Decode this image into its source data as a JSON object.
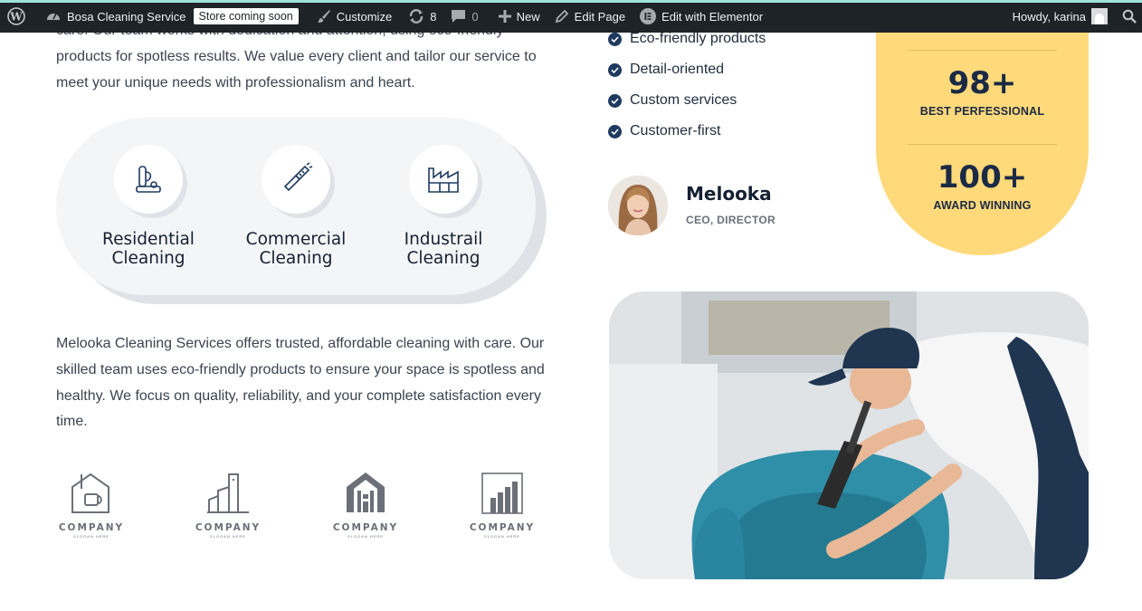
{
  "admin_bar": {
    "site_name": "Bosa Cleaning Service",
    "store_badge": "Store coming soon",
    "customize": "Customize",
    "updates_count": "8",
    "comments_count": "0",
    "new": "New",
    "edit_page": "Edit Page",
    "edit_elementor": "Edit with Elementor",
    "howdy": "Howdy, karina"
  },
  "intro": {
    "paragraph": "care. Our team works with dedication and attention, using eco-friendly products for spotless results. We value every client and tailor our service to meet your unique needs with professionalism and heart."
  },
  "services": [
    {
      "title_line1": "Residential",
      "title_line2": "Cleaning",
      "icon": "vacuum-icon"
    },
    {
      "title_line1": "Commercial",
      "title_line2": "Cleaning",
      "icon": "brush-icon"
    },
    {
      "title_line1": "Industrail",
      "title_line2": "Cleaning",
      "icon": "factory-icon"
    }
  ],
  "about": {
    "paragraph": "Melooka Cleaning Services offers trusted, affordable cleaning with care. Our skilled team uses eco-friendly products to ensure your space is spotless and healthy. We focus on quality, reliability, and your complete satisfaction every time."
  },
  "logos": [
    {
      "word": "COMPANY",
      "sub": "SLOGAN HERE",
      "icon": "house-logo-icon"
    },
    {
      "word": "COMPANY",
      "sub": "SLOGAN HERE",
      "icon": "buildings-logo-icon"
    },
    {
      "word": "COMPANY",
      "sub": "SLOGAN HERE",
      "icon": "home-logo-icon"
    },
    {
      "word": "COMPANY",
      "sub": "SLOGAN HERE",
      "icon": "city-logo-icon"
    }
  ],
  "features": [
    "Eco-friendly products",
    "Detail-oriented",
    "Custom services",
    "Customer-first"
  ],
  "person": {
    "name": "Melooka",
    "role": "CEO, DIRECTOR"
  },
  "stats": [
    {
      "number": "98+",
      "label": "BEST PERFESSIONAL"
    },
    {
      "number": "100+",
      "label": "AWARD WINNING"
    }
  ],
  "colors": {
    "admin_bar_bg": "#1d2327",
    "accent_yellow": "#ffd97a",
    "navy": "#1e3a5f",
    "pill_bg": "#f4f5f6",
    "chair_teal": "#2f8fa8"
  }
}
